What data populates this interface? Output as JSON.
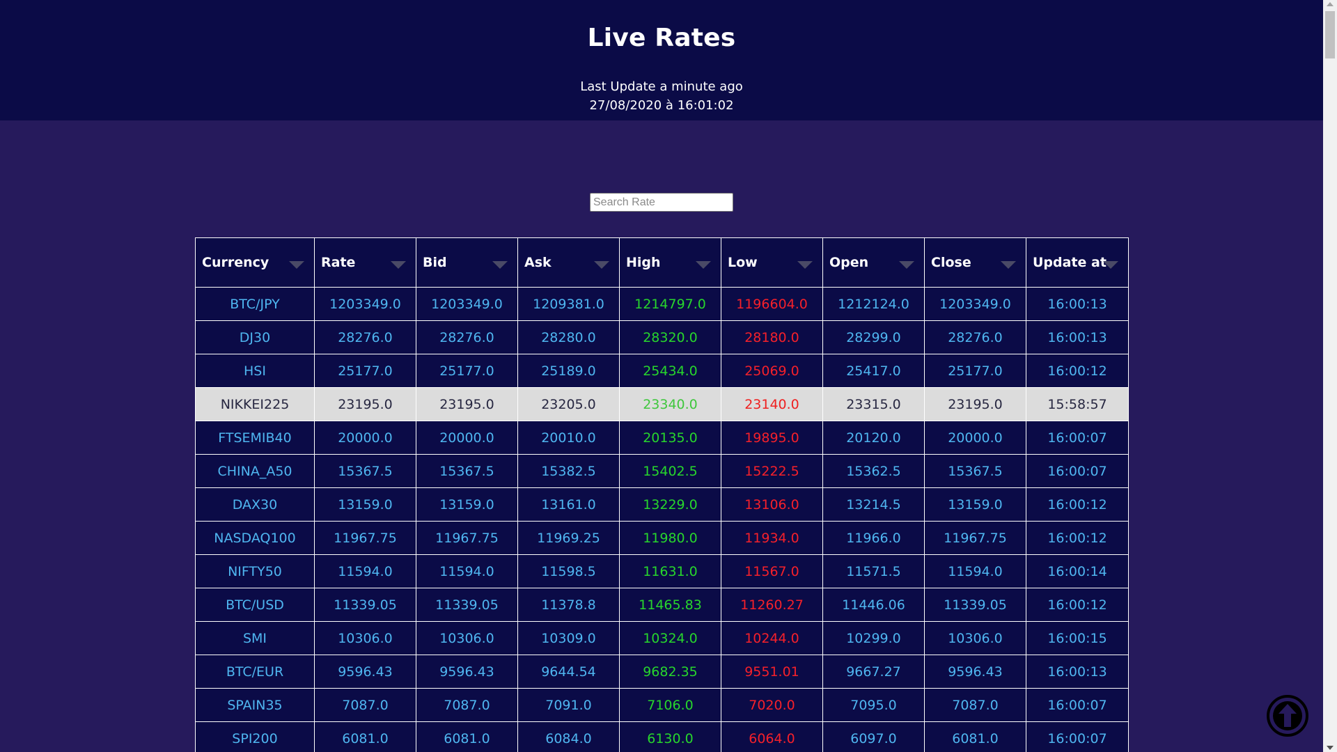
{
  "header": {
    "title": "Live Rates",
    "last_update_line1": "Last Update a minute ago",
    "last_update_line2": "27/08/2020 à 16:01:02"
  },
  "search": {
    "placeholder": "Search Rate",
    "value": ""
  },
  "table": {
    "columns": [
      "Currency",
      "Rate",
      "Bid",
      "Ask",
      "High",
      "Low",
      "Open",
      "Close",
      "Update at"
    ],
    "hover_row_index": 3,
    "rows": [
      [
        "BTC/JPY",
        "1203349.0",
        "1203349.0",
        "1209381.0",
        "1214797.0",
        "1196604.0",
        "1212124.0",
        "1203349.0",
        "16:00:13"
      ],
      [
        "DJ30",
        "28276.0",
        "28276.0",
        "28280.0",
        "28320.0",
        "28180.0",
        "28299.0",
        "28276.0",
        "16:00:13"
      ],
      [
        "HSI",
        "25177.0",
        "25177.0",
        "25189.0",
        "25434.0",
        "25069.0",
        "25417.0",
        "25177.0",
        "16:00:12"
      ],
      [
        "NIKKEI225",
        "23195.0",
        "23195.0",
        "23205.0",
        "23340.0",
        "23140.0",
        "23315.0",
        "23195.0",
        "15:58:57"
      ],
      [
        "FTSEMIB40",
        "20000.0",
        "20000.0",
        "20010.0",
        "20135.0",
        "19895.0",
        "20120.0",
        "20000.0",
        "16:00:07"
      ],
      [
        "CHINA_A50",
        "15367.5",
        "15367.5",
        "15382.5",
        "15402.5",
        "15222.5",
        "15362.5",
        "15367.5",
        "16:00:07"
      ],
      [
        "DAX30",
        "13159.0",
        "13159.0",
        "13161.0",
        "13229.0",
        "13106.0",
        "13214.5",
        "13159.0",
        "16:00:12"
      ],
      [
        "NASDAQ100",
        "11967.75",
        "11967.75",
        "11969.25",
        "11980.0",
        "11934.0",
        "11966.0",
        "11967.75",
        "16:00:12"
      ],
      [
        "NIFTY50",
        "11594.0",
        "11594.0",
        "11598.5",
        "11631.0",
        "11567.0",
        "11571.5",
        "11594.0",
        "16:00:14"
      ],
      [
        "BTC/USD",
        "11339.05",
        "11339.05",
        "11378.8",
        "11465.83",
        "11260.27",
        "11446.06",
        "11339.05",
        "16:00:12"
      ],
      [
        "SMI",
        "10306.0",
        "10306.0",
        "10309.0",
        "10324.0",
        "10244.0",
        "10299.0",
        "10306.0",
        "16:00:15"
      ],
      [
        "BTC/EUR",
        "9596.43",
        "9596.43",
        "9644.54",
        "9682.35",
        "9551.01",
        "9667.27",
        "9596.43",
        "16:00:13"
      ],
      [
        "SPAIN35",
        "7087.0",
        "7087.0",
        "7091.0",
        "7106.0",
        "7020.0",
        "7095.0",
        "7087.0",
        "16:00:07"
      ],
      [
        "SPI200",
        "6081.0",
        "6081.0",
        "6084.0",
        "6130.0",
        "6064.0",
        "6097.0",
        "6081.0",
        "16:00:07"
      ]
    ]
  },
  "colors": {
    "page_background": "#261a5c",
    "header_background": "#0b0b47",
    "cell_text": "#4fb6f0",
    "high_text": "#27d62c",
    "low_text": "#f5202a",
    "hover_row_background": "#dcdcdc"
  },
  "icons": {
    "sort": "caret-down-icon",
    "back_to_top": "arrow-up-circle-icon"
  }
}
